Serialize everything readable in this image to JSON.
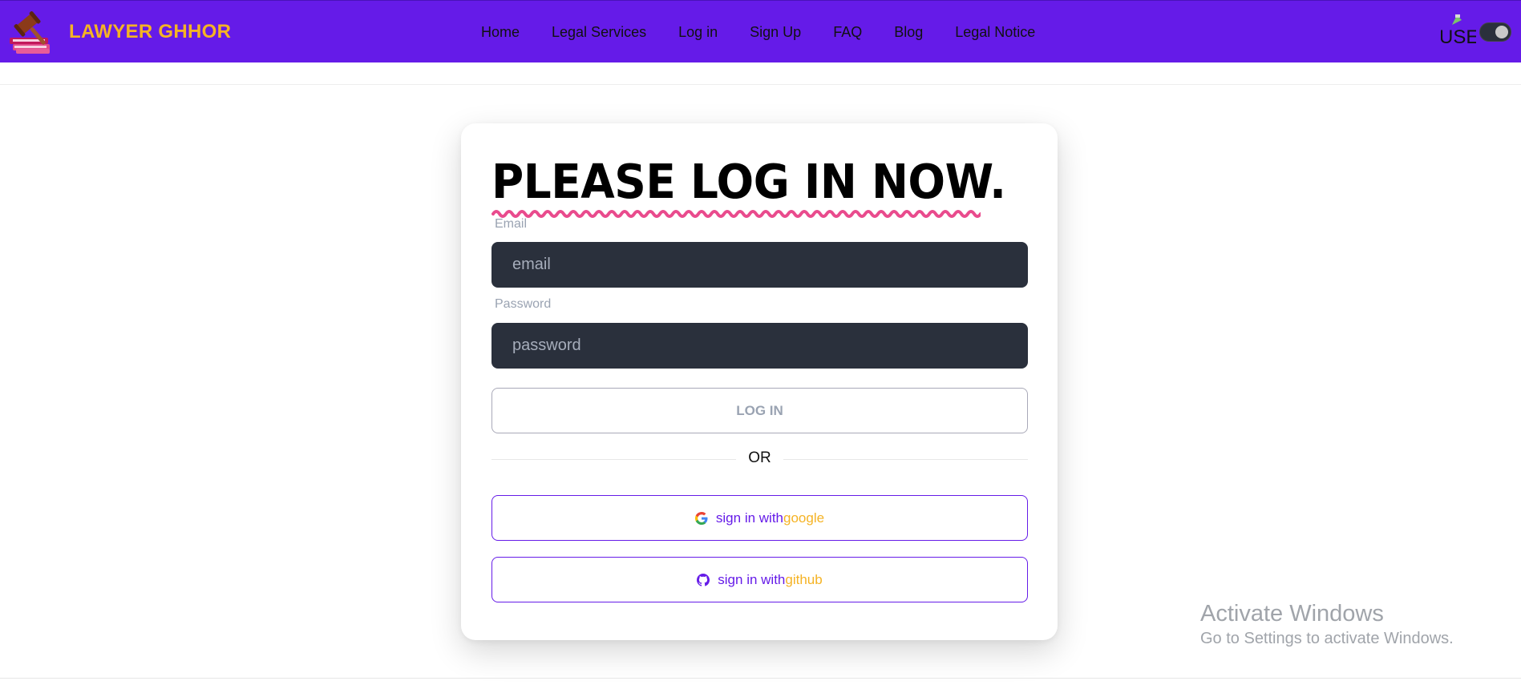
{
  "brand": {
    "name": "LAWYER GHHOR",
    "logo_icon": "gavel-books-icon",
    "color": "#f5b324"
  },
  "nav": {
    "background": "#651be8",
    "links": [
      "Home",
      "Legal Services",
      "Log in",
      "Sign Up",
      "FAQ",
      "Blog",
      "Legal Notice"
    ],
    "user_image_alt": "USE",
    "theme_toggle_icon": "theme-toggle-icon"
  },
  "login": {
    "title": "PLEASE LOG IN NOW.",
    "email_label": "Email",
    "email_placeholder": "email",
    "password_label": "Password",
    "password_placeholder": "password",
    "submit_label": "LOG IN",
    "divider_text": "OR",
    "google": {
      "prefix": "sign in with",
      "provider": "google",
      "icon": "google-icon"
    },
    "github": {
      "prefix": "sign in with",
      "provider": "github",
      "icon": "github-icon"
    }
  },
  "watermark": {
    "title": "Activate Windows",
    "subtitle": "Go to Settings to activate Windows."
  }
}
